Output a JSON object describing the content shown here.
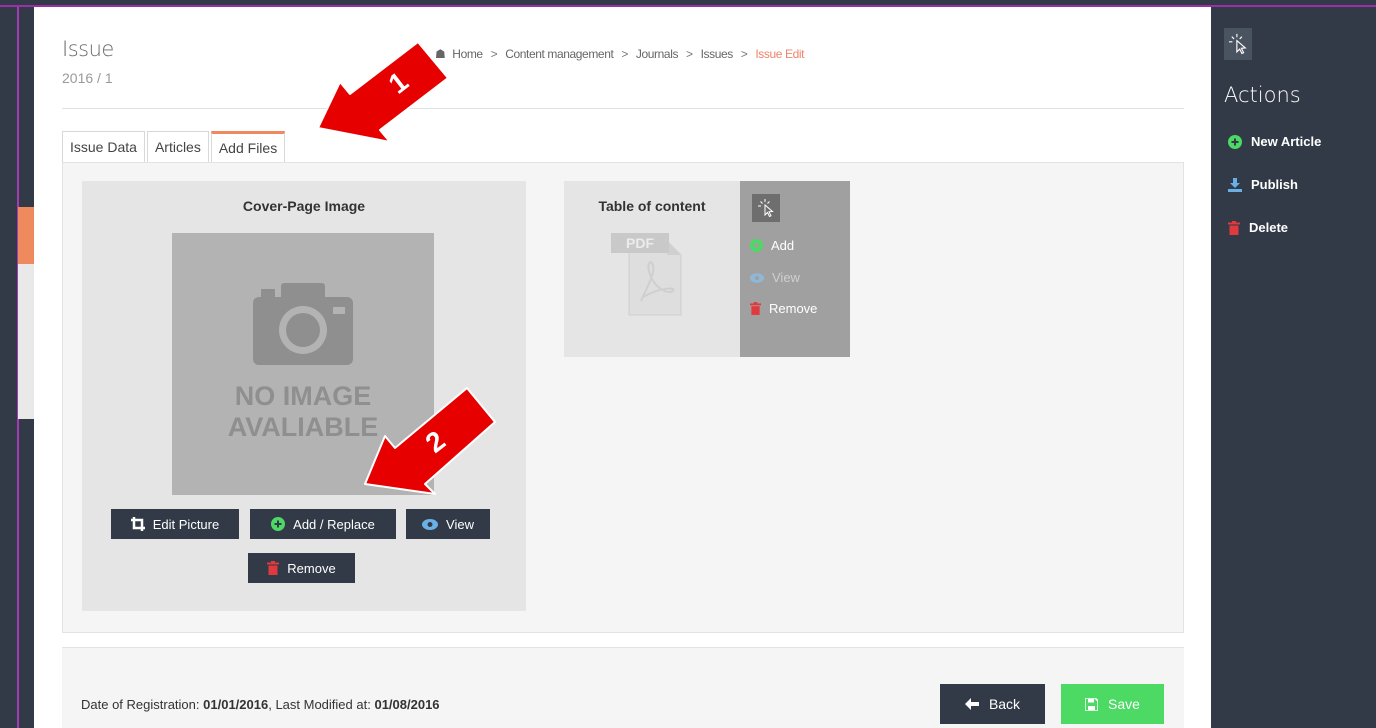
{
  "header": {
    "title": "Issue",
    "subtitle": "2016 / 1"
  },
  "breadcrumb": {
    "items": [
      "Home",
      "Content management",
      "Journals",
      "Issues"
    ],
    "active": "Issue Edit"
  },
  "tabs": [
    {
      "label": "Issue Data",
      "active": false
    },
    {
      "label": "Articles",
      "active": false
    },
    {
      "label": "Add Files",
      "active": true
    }
  ],
  "cover": {
    "title": "Cover-Page Image",
    "placeholder_line1": "NO IMAGE",
    "placeholder_line2": "AVALIABLE",
    "buttons": {
      "edit": "Edit Picture",
      "add": "Add / Replace",
      "view": "View",
      "remove": "Remove"
    }
  },
  "toc": {
    "title": "Table of content",
    "pdf_label": "PDF",
    "actions": {
      "add": "Add",
      "view": "View",
      "remove": "Remove"
    }
  },
  "footer": {
    "registration_label": "Date of Registration:",
    "registration_date": "01/01/2016",
    "modified_label": ", Last Modified at:",
    "modified_date": "01/08/2016",
    "back_label": "Back",
    "save_label": "Save"
  },
  "sidebar": {
    "heading": "Actions",
    "items": [
      {
        "label": "New Article",
        "icon": "plus-circle-icon",
        "color": "#4cd964"
      },
      {
        "label": "Publish",
        "icon": "download-icon",
        "color": "#6ab0e6"
      },
      {
        "label": "Delete",
        "icon": "trash-icon",
        "color": "#e0393e"
      }
    ]
  },
  "annotations": {
    "arrow1_label": "1",
    "arrow2_label": "2"
  },
  "colors": {
    "accent_orange": "#ee8a5d",
    "breadcrumb_active": "#f0836b",
    "dark": "#313a46",
    "success": "#4cd964",
    "danger": "#e0393e",
    "annotation_red": "#e60000"
  }
}
